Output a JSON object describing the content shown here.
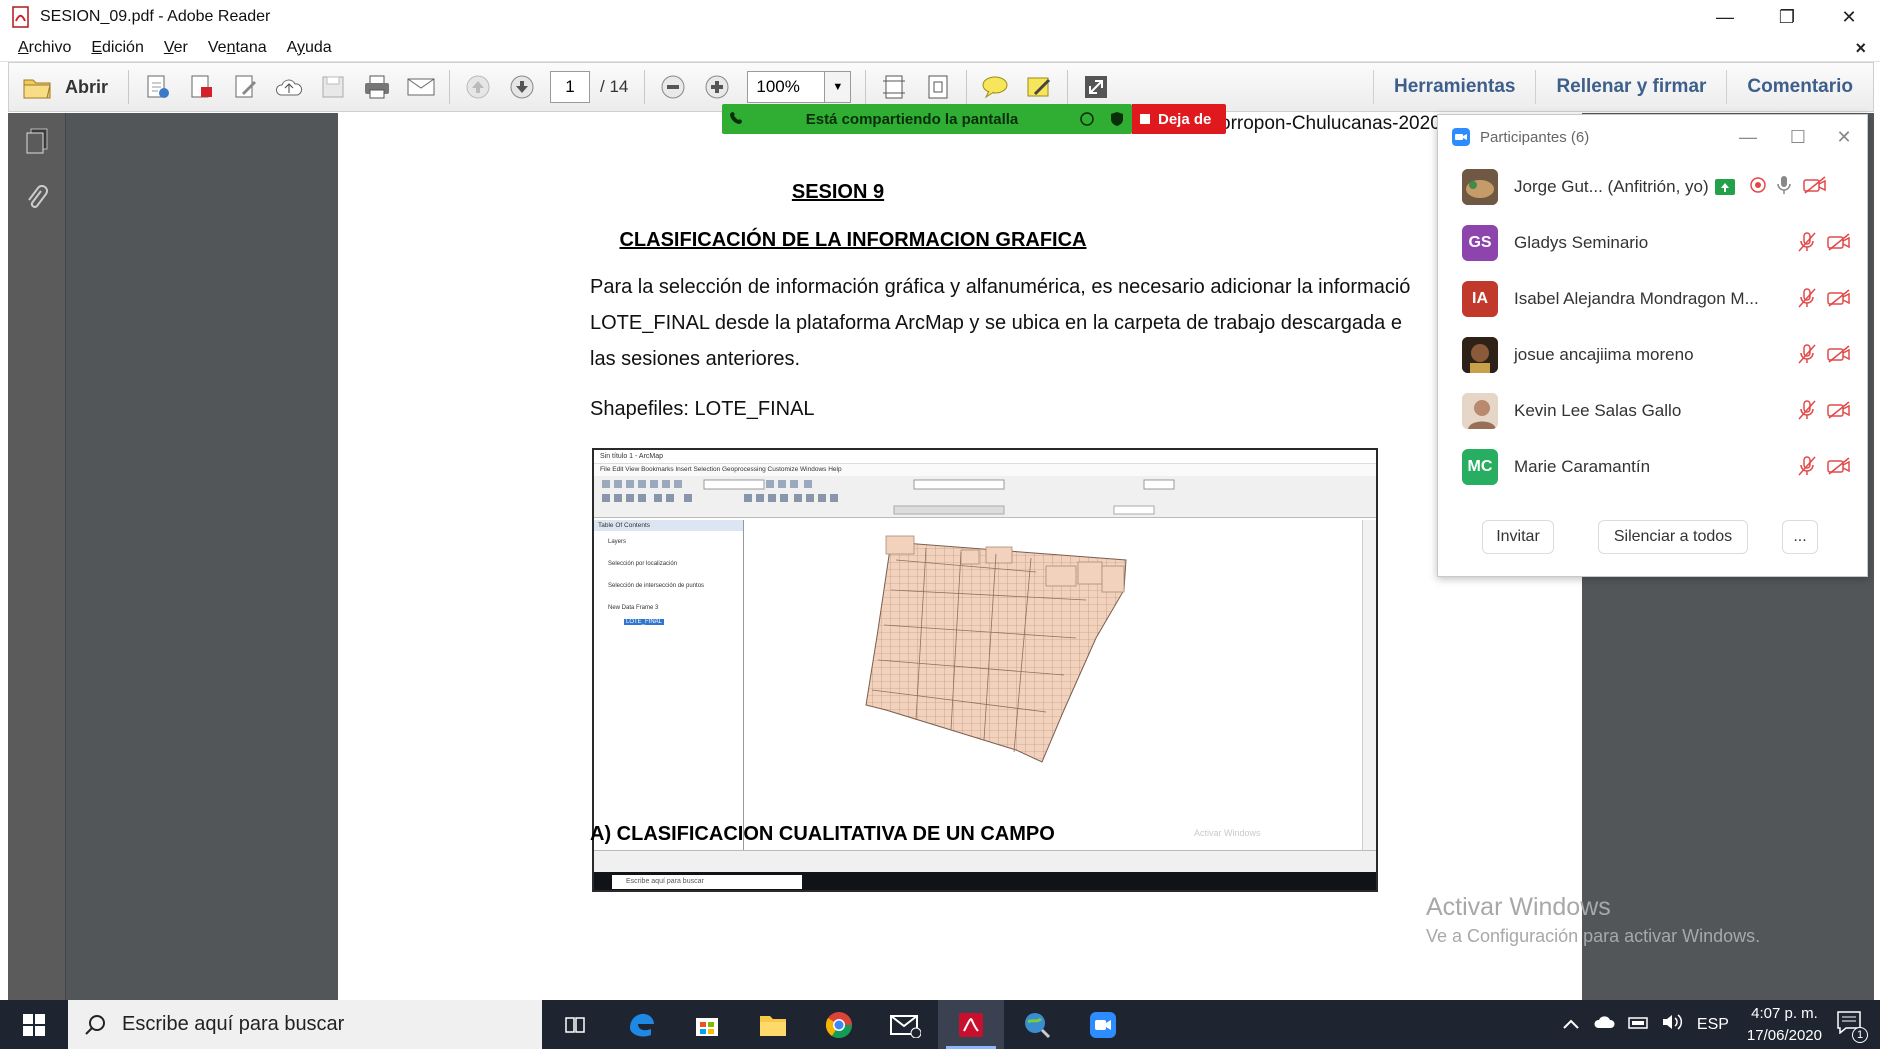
{
  "window": {
    "title": "SESION_09.pdf - Adobe Reader",
    "minimize": "—",
    "restore": "❐",
    "close": "✕"
  },
  "menu": {
    "items": [
      {
        "label": "Archivo",
        "underline": "A"
      },
      {
        "label": "Edición",
        "underline": "E"
      },
      {
        "label": "Ver",
        "underline": "V"
      },
      {
        "label": "Ventana",
        "underline": "n"
      },
      {
        "label": "Ayuda",
        "underline": "y"
      }
    ],
    "close_doc": "×"
  },
  "toolbar": {
    "open_label": "Abrir",
    "page_current": "1",
    "page_total": "/ 14",
    "zoom": "100%",
    "tabs": [
      "Herramientas",
      "Rellenar y firmar",
      "Comentario"
    ]
  },
  "share": {
    "message": "Está compartiendo la pantalla",
    "stop_label": "Deja de"
  },
  "document": {
    "header_snippet": "orropon-Chulucanas-2020",
    "session_title": "SESION 9",
    "section_title": "CLASIFICACIÓN DE LA INFORMACION GRAFICA",
    "paragraph_lines": [
      "Para la selección de información gráfica y alfanumérica, es necesario adicionar la informació",
      "LOTE_FINAL desde la plataforma ArcMap y se ubica en la carpeta de trabajo descargada e",
      "las sesiones anteriores."
    ],
    "shapefiles": "Shapefiles: LOTE_FINAL",
    "subsection": "A)  CLASIFICACION CUALITATIVA DE UN CAMPO"
  },
  "arcmap": {
    "title": "Sin título 1 - ArcMap",
    "menu": "File   Edit   View   Bookmarks   Insert   Selection   Geoprocessing   Customize   Windows   Help",
    "toc_title": "Table Of Contents",
    "toc_items": [
      "Layers",
      "Selección por localización",
      "Selección de intersección de puntos",
      "New Data Frame 3"
    ],
    "layer_selected": "LOTE_FINAL",
    "taskbar_search": "Escribe aquí para buscar",
    "watermark": "Activar Windows"
  },
  "activate_windows": {
    "line1": "Activar Windows",
    "line2": "Ve a Configuración para activar Windows."
  },
  "participants": {
    "title": "Participantes (6)",
    "people": [
      {
        "name": "Jorge Gut... (Anfitrión, yo)",
        "initials": "",
        "color": "#8a6a4a",
        "host": true
      },
      {
        "name": "Gladys Seminario",
        "initials": "GS",
        "color": "#8e44ad",
        "host": false
      },
      {
        "name": "Isabel Alejandra Mondragon M...",
        "initials": "IA",
        "color": "#c0392b",
        "host": false
      },
      {
        "name": "josue ancajiima moreno",
        "initials": "",
        "color": "#3b2a1a",
        "host": false
      },
      {
        "name": "Kevin Lee Salas Gallo",
        "initials": "",
        "color": "#b88a6e",
        "host": false
      },
      {
        "name": "Marie Caramantín",
        "initials": "MC",
        "color": "#27ae60",
        "host": false
      }
    ],
    "buttons": {
      "invite": "Invitar",
      "mute_all": "Silenciar a todos",
      "more": "..."
    }
  },
  "taskbar": {
    "search_placeholder": "Escribe aquí para buscar",
    "language": "ESP",
    "time": "4:07 p. m.",
    "date": "17/06/2020",
    "notification_count": "1"
  }
}
